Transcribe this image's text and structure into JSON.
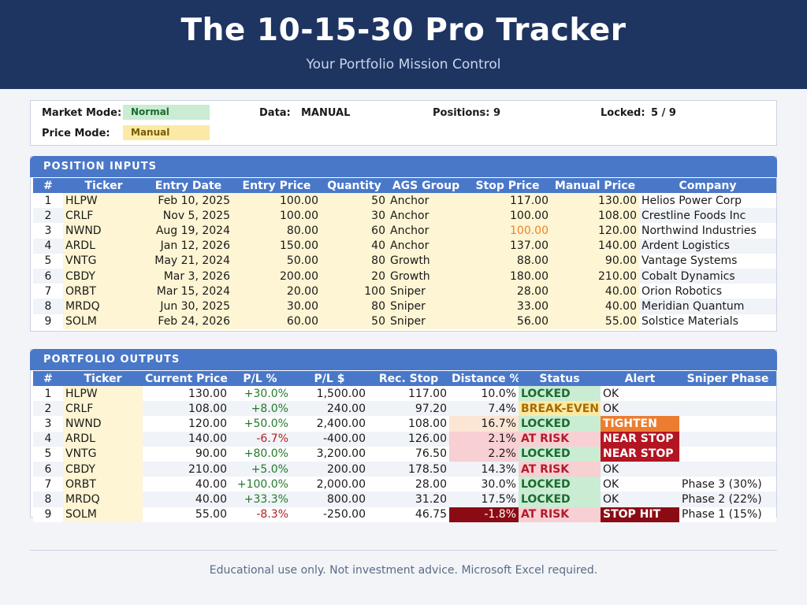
{
  "header": {
    "title": "The 10-15-30 Pro Tracker",
    "subtitle": "Your Portfolio Mission Control"
  },
  "summary": {
    "market_mode_label": "Market Mode:",
    "market_mode_value": "Normal",
    "price_mode_label": "Price Mode:",
    "price_mode_value": "Manual",
    "data_label": "Data:",
    "data_value": "MANUAL",
    "positions_label": "Positions:",
    "positions_value": "9",
    "locked_label": "Locked:",
    "locked_value": "5 / 9"
  },
  "inputs": {
    "section_title": "POSITION INPUTS",
    "columns": [
      "#",
      "Ticker",
      "Entry Date",
      "Entry Price",
      "Quantity",
      "AGS Group",
      "Stop Price",
      "Manual Price",
      "Company"
    ],
    "rows": [
      {
        "n": "1",
        "ticker": "HLPW",
        "entry_date": "Feb 10, 2025",
        "entry_price": "100.00",
        "qty": "50",
        "group": "Anchor",
        "stop": "117.00",
        "manual": "130.00",
        "company": "Helios Power Corp"
      },
      {
        "n": "2",
        "ticker": "CRLF",
        "entry_date": "Nov 5, 2025",
        "entry_price": "100.00",
        "qty": "30",
        "group": "Anchor",
        "stop": "100.00",
        "manual": "108.00",
        "company": "Crestline Foods Inc"
      },
      {
        "n": "3",
        "ticker": "NWND",
        "entry_date": "Aug 19, 2024",
        "entry_price": "80.00",
        "qty": "60",
        "group": "Anchor",
        "stop": "100.00",
        "manual": "120.00",
        "company": "Northwind Industries"
      },
      {
        "n": "4",
        "ticker": "ARDL",
        "entry_date": "Jan 12, 2026",
        "entry_price": "150.00",
        "qty": "40",
        "group": "Anchor",
        "stop": "137.00",
        "manual": "140.00",
        "company": "Ardent Logistics"
      },
      {
        "n": "5",
        "ticker": "VNTG",
        "entry_date": "May 21, 2024",
        "entry_price": "50.00",
        "qty": "80",
        "group": "Growth",
        "stop": "88.00",
        "manual": "90.00",
        "company": "Vantage Systems"
      },
      {
        "n": "6",
        "ticker": "CBDY",
        "entry_date": "Mar 3, 2026",
        "entry_price": "200.00",
        "qty": "20",
        "group": "Growth",
        "stop": "180.00",
        "manual": "210.00",
        "company": "Cobalt Dynamics"
      },
      {
        "n": "7",
        "ticker": "ORBT",
        "entry_date": "Mar 15, 2024",
        "entry_price": "20.00",
        "qty": "100",
        "group": "Sniper",
        "stop": "28.00",
        "manual": "40.00",
        "company": "Orion Robotics"
      },
      {
        "n": "8",
        "ticker": "MRDQ",
        "entry_date": "Jun 30, 2025",
        "entry_price": "30.00",
        "qty": "80",
        "group": "Sniper",
        "stop": "33.00",
        "manual": "40.00",
        "company": "Meridian Quantum"
      },
      {
        "n": "9",
        "ticker": "SOLM",
        "entry_date": "Feb 24, 2026",
        "entry_price": "60.00",
        "qty": "50",
        "group": "Sniper",
        "stop": "56.00",
        "manual": "55.00",
        "company": "Solstice Materials"
      }
    ]
  },
  "outputs": {
    "section_title": "PORTFOLIO OUTPUTS",
    "columns": [
      "#",
      "Ticker",
      "Current Price",
      "P/L %",
      "P/L $",
      "Rec. Stop",
      "Distance %",
      "Status",
      "Alert",
      "Sniper Phase"
    ],
    "rows": [
      {
        "n": "1",
        "ticker": "HLPW",
        "price": "130.00",
        "plpct": "+30.0%",
        "pld": "1,500.00",
        "rec": "117.00",
        "dist": "10.0%",
        "status": "LOCKED",
        "alert": "OK",
        "phase": ""
      },
      {
        "n": "2",
        "ticker": "CRLF",
        "price": "108.00",
        "plpct": "+8.0%",
        "pld": "240.00",
        "rec": "97.20",
        "dist": "7.4%",
        "status": "BREAK-EVEN",
        "alert": "OK",
        "phase": ""
      },
      {
        "n": "3",
        "ticker": "NWND",
        "price": "120.00",
        "plpct": "+50.0%",
        "pld": "2,400.00",
        "rec": "108.00",
        "dist": "16.7%",
        "status": "LOCKED",
        "alert": "TIGHTEN",
        "phase": ""
      },
      {
        "n": "4",
        "ticker": "ARDL",
        "price": "140.00",
        "plpct": "-6.7%",
        "pld": "-400.00",
        "rec": "126.00",
        "dist": "2.1%",
        "status": "AT RISK",
        "alert": "NEAR STOP",
        "phase": ""
      },
      {
        "n": "5",
        "ticker": "VNTG",
        "price": "90.00",
        "plpct": "+80.0%",
        "pld": "3,200.00",
        "rec": "76.50",
        "dist": "2.2%",
        "status": "LOCKED",
        "alert": "NEAR STOP",
        "phase": ""
      },
      {
        "n": "6",
        "ticker": "CBDY",
        "price": "210.00",
        "plpct": "+5.0%",
        "pld": "200.00",
        "rec": "178.50",
        "dist": "14.3%",
        "status": "AT RISK",
        "alert": "OK",
        "phase": ""
      },
      {
        "n": "7",
        "ticker": "ORBT",
        "price": "40.00",
        "plpct": "+100.0%",
        "pld": "2,000.00",
        "rec": "28.00",
        "dist": "30.0%",
        "status": "LOCKED",
        "alert": "OK",
        "phase": "Phase 3 (30%)"
      },
      {
        "n": "8",
        "ticker": "MRDQ",
        "price": "40.00",
        "plpct": "+33.3%",
        "pld": "800.00",
        "rec": "31.20",
        "dist": "17.5%",
        "status": "LOCKED",
        "alert": "OK",
        "phase": "Phase 2 (22%)"
      },
      {
        "n": "9",
        "ticker": "SOLM",
        "price": "55.00",
        "plpct": "-8.3%",
        "pld": "-250.00",
        "rec": "46.75",
        "dist": "-1.8%",
        "status": "AT RISK",
        "alert": "STOP HIT",
        "phase": "Phase 1 (15%)"
      }
    ]
  },
  "footer": {
    "text": "Educational use only. Not investment advice. Microsoft Excel required."
  },
  "colors": {
    "header_bg": "#1e3461",
    "section_bar": "#4a78c9",
    "locked_bg": "#c9ecd3",
    "at_risk_bg": "#f8cfd3",
    "break_even_bg": "#fbeaa5",
    "tighten_bg": "#ec7d30",
    "near_stop_bg": "#b41523",
    "stop_hit_bg": "#8b0b14",
    "positive_text": "#237a2c",
    "negative_text": "#b32222"
  }
}
